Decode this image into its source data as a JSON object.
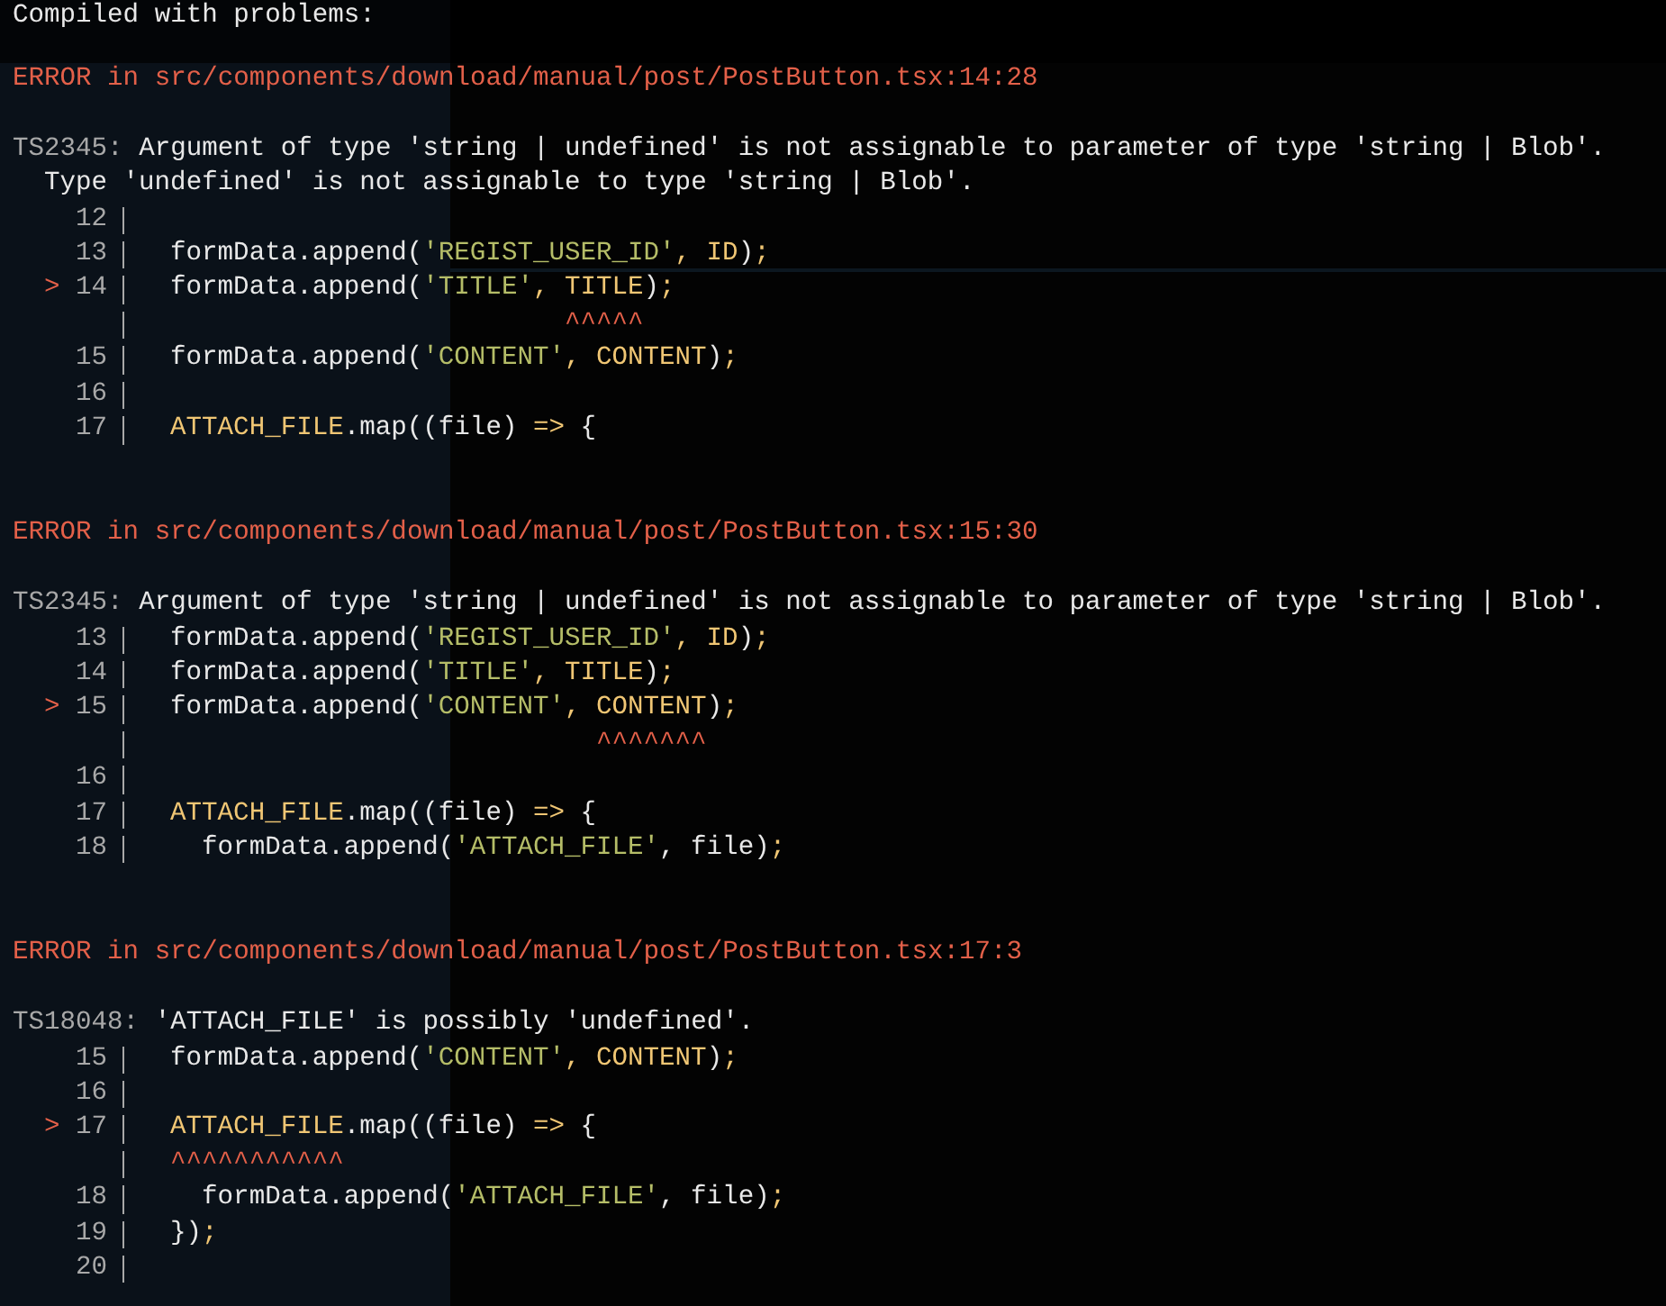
{
  "overlay": {
    "title": "Compiled with problems:",
    "errors": [
      {
        "location": "ERROR in src/components/download/manual/post/PostButton.tsx:14:28",
        "code": "TS2345:",
        "message": [
          "Argument of type 'string | undefined' is not assignable to parameter of type 'string | Blob'.",
          "Type 'undefined' is not assignable to type 'string | Blob'."
        ],
        "frame": [
          {
            "kind": "line",
            "number": "12"
          },
          {
            "kind": "line",
            "number": "13",
            "tokens": [
              {
                "kind": "plain",
                "text": "formData.append("
              },
              {
                "kind": "string",
                "text": "'REGIST_USER_ID'"
              },
              {
                "kind": "punct",
                "text": ", "
              },
              {
                "kind": "ident",
                "text": "ID"
              },
              {
                "kind": "plain",
                "text": ")"
              },
              {
                "kind": "punct",
                "text": ";"
              }
            ]
          },
          {
            "kind": "line",
            "number": "14",
            "marker": ">",
            "tokens": [
              {
                "kind": "plain",
                "text": "formData.append("
              },
              {
                "kind": "string",
                "text": "'TITLE'"
              },
              {
                "kind": "punct",
                "text": ", "
              },
              {
                "kind": "ident",
                "text": "TITLE",
                "pointed": true
              },
              {
                "kind": "plain",
                "text": ")"
              },
              {
                "kind": "punct",
                "text": ";"
              }
            ]
          },
          {
            "kind": "pointer",
            "text": "^^^^^"
          },
          {
            "kind": "line",
            "number": "15",
            "tokens": [
              {
                "kind": "plain",
                "text": "formData.append("
              },
              {
                "kind": "string",
                "text": "'CONTENT'"
              },
              {
                "kind": "punct",
                "text": ", "
              },
              {
                "kind": "ident",
                "text": "CONTENT"
              },
              {
                "kind": "plain",
                "text": ")"
              },
              {
                "kind": "punct",
                "text": ";"
              }
            ]
          },
          {
            "kind": "line",
            "number": "16"
          },
          {
            "kind": "line",
            "number": "17",
            "tokens": [
              {
                "kind": "ident",
                "text": "ATTACH_FILE"
              },
              {
                "kind": "plain",
                "text": ".map((file) "
              },
              {
                "kind": "punct",
                "text": "=>"
              },
              {
                "kind": "plain",
                "text": " {"
              }
            ]
          }
        ]
      },
      {
        "location": "ERROR in src/components/download/manual/post/PostButton.tsx:15:30",
        "code": "TS2345:",
        "message": [
          "Argument of type 'string | undefined' is not assignable to parameter of type 'string | Blob'."
        ],
        "frame": [
          {
            "kind": "line",
            "number": "13",
            "tokens": [
              {
                "kind": "plain",
                "text": "formData.append("
              },
              {
                "kind": "string",
                "text": "'REGIST_USER_ID'"
              },
              {
                "kind": "punct",
                "text": ", "
              },
              {
                "kind": "ident",
                "text": "ID"
              },
              {
                "kind": "plain",
                "text": ")"
              },
              {
                "kind": "punct",
                "text": ";"
              }
            ]
          },
          {
            "kind": "line",
            "number": "14",
            "tokens": [
              {
                "kind": "plain",
                "text": "formData.append("
              },
              {
                "kind": "string",
                "text": "'TITLE'"
              },
              {
                "kind": "punct",
                "text": ", "
              },
              {
                "kind": "ident",
                "text": "TITLE"
              },
              {
                "kind": "plain",
                "text": ")"
              },
              {
                "kind": "punct",
                "text": ";"
              }
            ]
          },
          {
            "kind": "line",
            "number": "15",
            "marker": ">",
            "tokens": [
              {
                "kind": "plain",
                "text": "formData.append("
              },
              {
                "kind": "string",
                "text": "'CONTENT'"
              },
              {
                "kind": "punct",
                "text": ", "
              },
              {
                "kind": "ident",
                "text": "CONTENT",
                "pointed": true
              },
              {
                "kind": "plain",
                "text": ")"
              },
              {
                "kind": "punct",
                "text": ";"
              }
            ]
          },
          {
            "kind": "pointer",
            "text": "^^^^^^^"
          },
          {
            "kind": "line",
            "number": "16"
          },
          {
            "kind": "line",
            "number": "17",
            "tokens": [
              {
                "kind": "ident",
                "text": "ATTACH_FILE"
              },
              {
                "kind": "plain",
                "text": ".map((file) "
              },
              {
                "kind": "punct",
                "text": "=>"
              },
              {
                "kind": "plain",
                "text": " {"
              }
            ]
          },
          {
            "kind": "line",
            "number": "18",
            "tokens": [
              {
                "kind": "plain",
                "text": "  formData.append("
              },
              {
                "kind": "string",
                "text": "'ATTACH_FILE'"
              },
              {
                "kind": "plain",
                "text": ", file)"
              },
              {
                "kind": "punct",
                "text": ";"
              }
            ]
          }
        ]
      },
      {
        "location": "ERROR in src/components/download/manual/post/PostButton.tsx:17:3",
        "code": "TS18048:",
        "message": [
          "'ATTACH_FILE' is possibly 'undefined'."
        ],
        "frame": [
          {
            "kind": "line",
            "number": "15",
            "tokens": [
              {
                "kind": "plain",
                "text": "formData.append("
              },
              {
                "kind": "string",
                "text": "'CONTENT'"
              },
              {
                "kind": "punct",
                "text": ", "
              },
              {
                "kind": "ident",
                "text": "CONTENT"
              },
              {
                "kind": "plain",
                "text": ")"
              },
              {
                "kind": "punct",
                "text": ";"
              }
            ]
          },
          {
            "kind": "line",
            "number": "16"
          },
          {
            "kind": "line",
            "number": "17",
            "marker": ">",
            "tokens": [
              {
                "kind": "ident",
                "text": "ATTACH_FILE",
                "pointed": true
              },
              {
                "kind": "plain",
                "text": ".map((file) "
              },
              {
                "kind": "punct",
                "text": "=>"
              },
              {
                "kind": "plain",
                "text": " {"
              }
            ]
          },
          {
            "kind": "pointer",
            "text": "^^^^^^^^^^^"
          },
          {
            "kind": "line",
            "number": "18",
            "tokens": [
              {
                "kind": "plain",
                "text": "  formData.append("
              },
              {
                "kind": "string",
                "text": "'ATTACH_FILE'"
              },
              {
                "kind": "plain",
                "text": ", file)"
              },
              {
                "kind": "punct",
                "text": ";"
              }
            ]
          },
          {
            "kind": "line",
            "number": "19",
            "tokens": [
              {
                "kind": "plain",
                "text": "})"
              },
              {
                "kind": "punct",
                "text": ";"
              }
            ]
          },
          {
            "kind": "line",
            "number": "20"
          }
        ]
      }
    ]
  }
}
